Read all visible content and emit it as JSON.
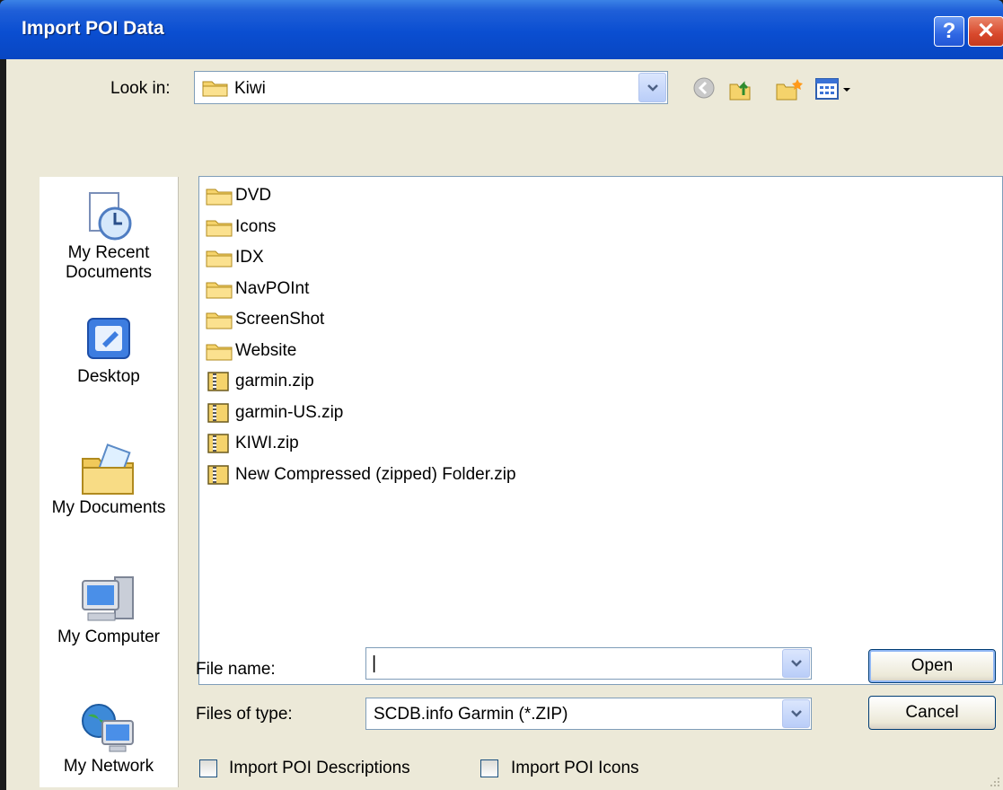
{
  "window": {
    "title": "Import POI Data"
  },
  "titlebar": {
    "help_label": "?",
    "close_label": "✕"
  },
  "look_in": {
    "label": "Look in:",
    "value": "Kiwi"
  },
  "places": [
    {
      "label_line1": "My Recent",
      "label_line2": "Documents"
    },
    {
      "label_line1": "Desktop"
    },
    {
      "label_line1": "My Documents"
    },
    {
      "label_line1": "My Computer"
    },
    {
      "label_line1": "My Network"
    }
  ],
  "files": [
    {
      "name": "DVD",
      "type": "folder"
    },
    {
      "name": "Icons",
      "type": "folder"
    },
    {
      "name": "IDX",
      "type": "folder"
    },
    {
      "name": "NavPOInt",
      "type": "folder"
    },
    {
      "name": "ScreenShot",
      "type": "folder"
    },
    {
      "name": "Website",
      "type": "folder"
    },
    {
      "name": "garmin.zip",
      "type": "zip"
    },
    {
      "name": "garmin-US.zip",
      "type": "zip"
    },
    {
      "name": "KIWI.zip",
      "type": "zip"
    },
    {
      "name": "New Compressed (zipped) Folder.zip",
      "type": "zip"
    }
  ],
  "file_name": {
    "label": "File name:",
    "value": "|"
  },
  "file_type": {
    "label": "Files of type:",
    "value": "SCDB.info Garmin (*.ZIP)"
  },
  "buttons": {
    "open": "Open",
    "cancel": "Cancel"
  },
  "options": {
    "descriptions": "Import POI Descriptions",
    "icons": "Import POI Icons"
  },
  "colors": {
    "title_bar": "#0a4ed1",
    "dialog_bg": "#ece9d8",
    "folder": "#f5d36b"
  }
}
